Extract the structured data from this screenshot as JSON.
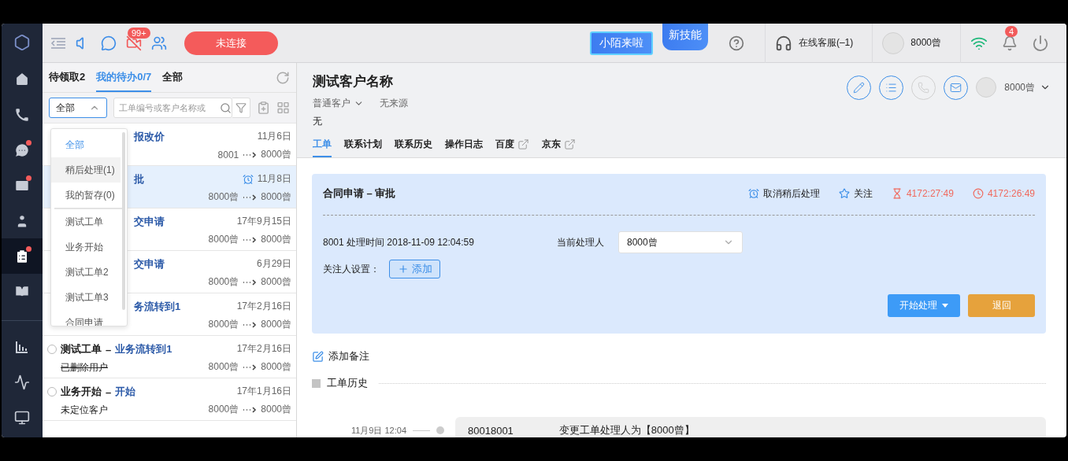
{
  "sidebar": {
    "items": [
      {
        "selected": false,
        "dot": false
      },
      {
        "selected": false,
        "dot": false
      },
      {
        "selected": false,
        "dot": true
      },
      {
        "selected": false,
        "dot": true
      },
      {
        "selected": false,
        "dot": false
      },
      {
        "selected": true,
        "dot": true
      },
      {
        "selected": false,
        "dot": false
      }
    ],
    "tools": [
      {
        "selected": false
      },
      {
        "selected": false
      },
      {
        "selected": false
      }
    ]
  },
  "topbar": {
    "video_badge": "99+",
    "connect_button": "未连接",
    "promo_1": "小陌来啦",
    "promo_2": "新技能",
    "service": "在线客服(–1)",
    "user": "8000曾",
    "bell_badge": "4"
  },
  "list_panel": {
    "tabs": [
      {
        "label": "待领取2",
        "selected": false
      },
      {
        "label": "我的待办0/7",
        "selected": true
      },
      {
        "label": "全部",
        "selected": false
      }
    ],
    "filter": {
      "value": "全部",
      "expanded": true
    },
    "search": {
      "placeholder": "工单编号或客户名称或"
    },
    "dropdown": {
      "special": [
        {
          "label": "全部",
          "selected": true,
          "hovered": false
        },
        {
          "label": "稍后处理(1)",
          "selected": false,
          "hovered": true
        },
        {
          "label": "我的暂存(0)",
          "selected": false,
          "hovered": false
        }
      ],
      "types": [
        {
          "label": "测试工单",
          "selected": false,
          "hovered": false
        },
        {
          "label": "业务开始",
          "selected": false,
          "hovered": false
        },
        {
          "label": "测试工单2",
          "selected": false,
          "hovered": false
        },
        {
          "label": "测试工单3",
          "selected": false,
          "hovered": false
        },
        {
          "label": "合同申请",
          "selected": false,
          "hovered": false
        }
      ]
    },
    "rows": [
      {
        "stage": "报改价",
        "date": "11月6日",
        "from": "8001",
        "to": "8000曾",
        "selected": false,
        "alarm": false
      },
      {
        "stage": "批",
        "date": "11月8日",
        "from": "8000曾",
        "to": "8000曾",
        "selected": true,
        "alarm": true
      },
      {
        "stage": "交申请",
        "date": "17年9月15日",
        "from": "8000曾",
        "to": "8000曾",
        "selected": false,
        "alarm": false
      },
      {
        "stage": "交申请",
        "date": "6月29日",
        "from": "8000曾",
        "to": "8000曾",
        "selected": false,
        "alarm": false
      },
      {
        "stage": "务流转到1",
        "date": "17年2月16日",
        "from": "8000曾",
        "to": "8000曾",
        "selected": false,
        "alarm": false
      },
      {
        "title": "测试工单",
        "dash": "–",
        "stage": "业务流转到1",
        "subtitle": "已删除用户",
        "struck": true,
        "date": "17年2月16日",
        "from": "8000曾",
        "to": "8000曾",
        "selected": false,
        "alarm": false
      },
      {
        "title": "业务开始",
        "dash": "–",
        "stage": "开始",
        "subtitle": "未定位客户",
        "struck": false,
        "date": "17年1月16日",
        "from": "8000曾",
        "to": "8000曾",
        "selected": false,
        "alarm": false
      }
    ]
  },
  "customer": {
    "name": "测试客户名称",
    "type": "普通客户",
    "source": "无来源",
    "note": "无",
    "actions": [
      {
        "disabled": false
      },
      {
        "disabled": false
      },
      {
        "disabled": true
      },
      {
        "disabled": false
      }
    ],
    "owner": "8000曾",
    "tabs": [
      {
        "label": "工单",
        "selected": true,
        "external": false
      },
      {
        "label": "联系计划",
        "selected": false,
        "external": false
      },
      {
        "label": "联系历史",
        "selected": false,
        "external": false
      },
      {
        "label": "操作日志",
        "selected": false,
        "external": false
      },
      {
        "label": "百度",
        "selected": false,
        "external": true
      },
      {
        "label": "京东",
        "selected": false,
        "external": true
      }
    ]
  },
  "ticket": {
    "title": "合同申请 – 审批",
    "snooze": "取消稍后处理",
    "follow": "关注",
    "timer_1": "4172:27:49",
    "timer_2": "4172:26:49",
    "handler_info": "8001 处理时间 2018-11-09 12:04:59",
    "handler_label": "当前处理人",
    "handler_value": "8000曾",
    "watchers_label": "关注人设置：",
    "add_button": "添加",
    "start_button": "开始处理",
    "return_button": "退回"
  },
  "add_note": "添加备注",
  "history": {
    "title": "工单历史",
    "entries": [
      {
        "time": "11月9日 12:04",
        "user": "80018001",
        "action": "变更工单处理人为【8000曾】"
      }
    ]
  }
}
